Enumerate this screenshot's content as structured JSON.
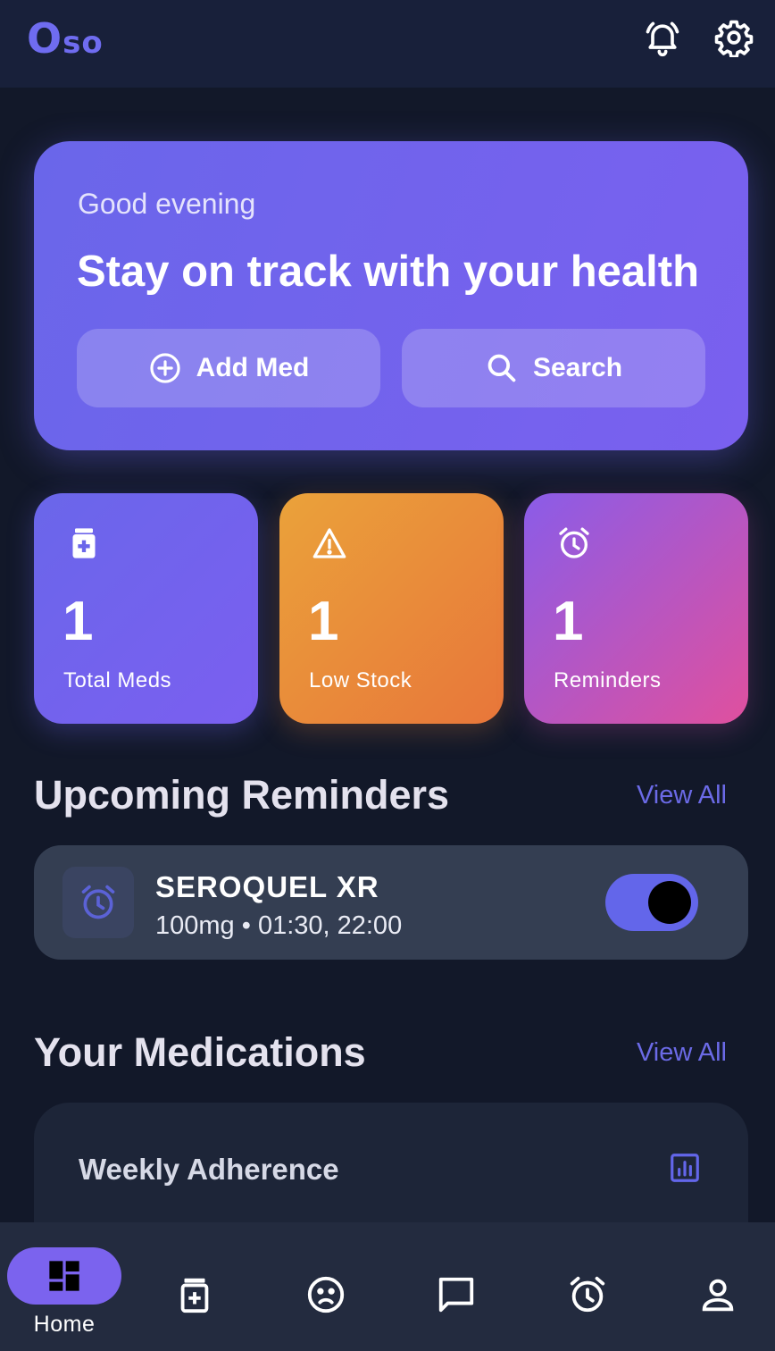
{
  "app": {
    "logo_big": "O",
    "logo_small": "so"
  },
  "hero": {
    "greeting": "Good evening",
    "tagline": "Stay on track with your health",
    "add_label": "Add Med",
    "search_label": "Search"
  },
  "stats": [
    {
      "value": "1",
      "label": "Total Meds",
      "icon": "medication-icon"
    },
    {
      "value": "1",
      "label": "Low Stock",
      "icon": "warning-icon"
    },
    {
      "value": "1",
      "label": "Reminders",
      "icon": "alarm-icon"
    }
  ],
  "reminders_section": {
    "title": "Upcoming Reminders",
    "view_all": "View All"
  },
  "reminder": {
    "name": "SEROQUEL XR",
    "detail": "100mg • 01:30, 22:00",
    "enabled": true
  },
  "meds_section": {
    "title": "Your Medications",
    "view_all": "View All"
  },
  "adherence": {
    "title": "Weekly Adherence",
    "icon": "chart-icon"
  },
  "nav": {
    "home_label": "Home",
    "items": [
      "home-icon",
      "medication-icon",
      "mood-icon",
      "chat-icon",
      "alarm-icon",
      "profile-icon"
    ]
  },
  "colors": {
    "background": "#121829",
    "accent": "#6f6cf0",
    "hero_gradient": [
      "#6a66ea",
      "#7a60ef"
    ],
    "stat_total": [
      "#6a66ea",
      "#7b5ff0"
    ],
    "stat_low": [
      "#eaa23a",
      "#e8763a"
    ],
    "stat_reminders": [
      "#8a5ce8",
      "#e0509e"
    ]
  }
}
